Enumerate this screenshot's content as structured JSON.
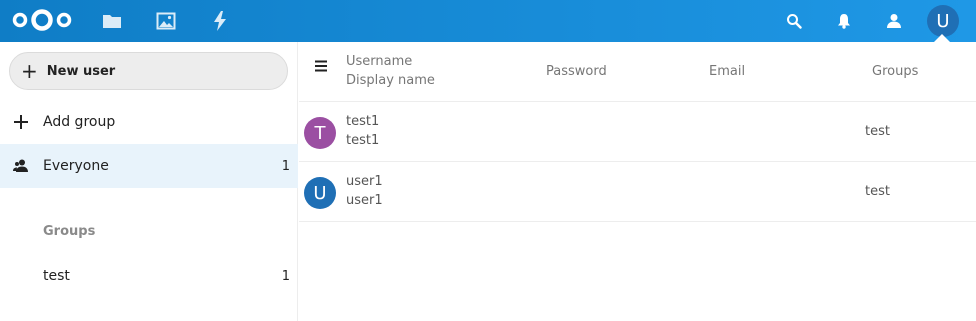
{
  "header": {
    "avatar_letter": "U",
    "brand_color": "#0082c9",
    "apps": [
      {
        "name": "files",
        "icon": "folder-icon"
      },
      {
        "name": "photos",
        "icon": "image-icon"
      },
      {
        "name": "activity",
        "icon": "lightning-icon"
      }
    ],
    "right_icons": [
      "search-icon",
      "bell-icon",
      "contacts-icon"
    ]
  },
  "sidebar": {
    "new_user_label": "New user",
    "add_group_label": "Add group",
    "everyone": {
      "label": "Everyone",
      "count": "1"
    },
    "groups_caption": "Groups",
    "groups": [
      {
        "label": "test",
        "count": "1"
      }
    ]
  },
  "table": {
    "headers": {
      "username": "Username",
      "display_name": "Display name",
      "password": "Password",
      "email": "Email",
      "groups": "Groups"
    },
    "rows": [
      {
        "avatar": "T",
        "avatar_color": "#9b4fa2",
        "username": "test1",
        "display_name": "test1",
        "groups": "test"
      },
      {
        "avatar": "U",
        "avatar_color": "#1f6fb5",
        "username": "user1",
        "display_name": "user1",
        "groups": "test"
      }
    ]
  }
}
